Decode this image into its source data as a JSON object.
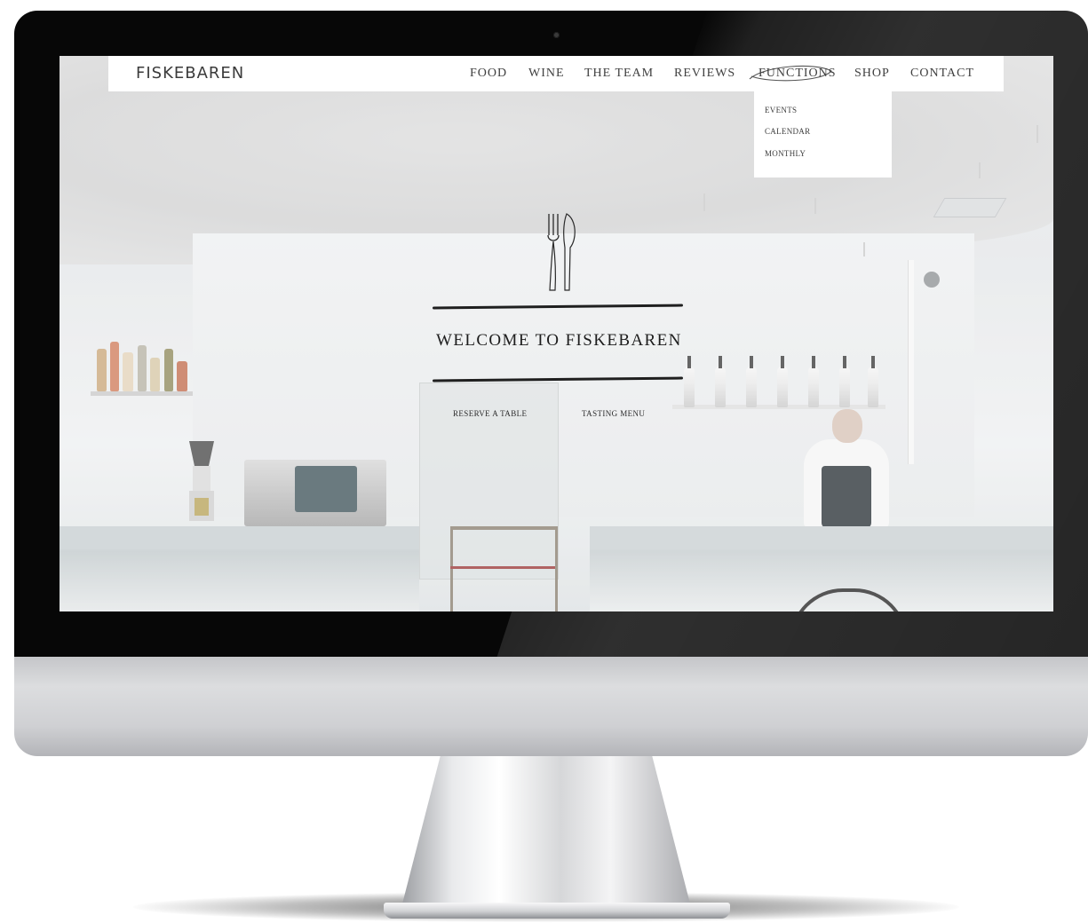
{
  "site": {
    "logo": "FISKEBAREN"
  },
  "nav": {
    "items": [
      {
        "label": "FOOD"
      },
      {
        "label": "WINE"
      },
      {
        "label": "THE TEAM"
      },
      {
        "label": "REVIEWS"
      },
      {
        "label": "FUNCTIONS",
        "active": true
      },
      {
        "label": "SHOP"
      },
      {
        "label": "CONTACT"
      }
    ],
    "dropdown": {
      "items": [
        {
          "label": "EVENTS"
        },
        {
          "label": "CALENDAR"
        },
        {
          "label": "MONTHLY"
        }
      ]
    }
  },
  "hero": {
    "icon": "cutlery-icon",
    "title": "WELCOME TO FISKEBAREN",
    "buttons": [
      {
        "label": "RESERVE A TABLE"
      },
      {
        "label": "TASTING MENU"
      }
    ]
  },
  "colors": {
    "nav_bg": "#ffffff",
    "text": "#3b3b3b",
    "bezel": "#070707"
  }
}
